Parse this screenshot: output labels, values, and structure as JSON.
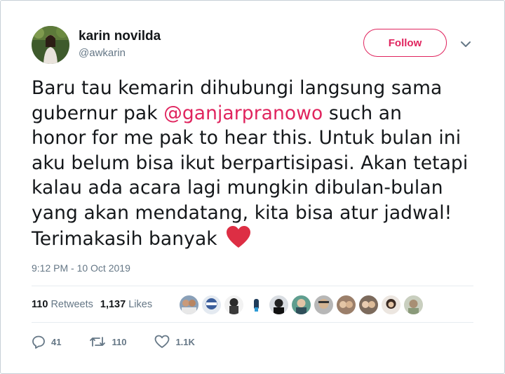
{
  "user": {
    "name": "karin novilda",
    "handle": "@awkarin"
  },
  "follow_button": {
    "label": "Follow"
  },
  "tweet": {
    "lines": [
      "Baru tau kemarin dihubungi langsung sama",
      "gubernur pak ",
      " such an",
      "honor for me pak to hear this. Untuk bulan ini",
      "aku belum bisa ikut berpartisipasi. Akan tetapi",
      "kalau ada acara lagi mungkin dibulan-bulan",
      "yang akan mendatang, kita bisa atur jadwal!",
      "Terimakasih banyak "
    ],
    "mention": "@ganjarpranowo",
    "timestamp": "9:12 PM - 10 Oct 2019"
  },
  "stats": {
    "retweets_count": "110",
    "retweets_label": "Retweets",
    "likes_count": "1,137",
    "likes_label": "Likes"
  },
  "likers": [
    {
      "icon": "liker-avatar-1"
    },
    {
      "icon": "liker-avatar-2"
    },
    {
      "icon": "liker-avatar-3"
    },
    {
      "icon": "liker-avatar-4"
    },
    {
      "icon": "liker-avatar-5"
    },
    {
      "icon": "liker-avatar-6"
    },
    {
      "icon": "liker-avatar-7"
    },
    {
      "icon": "liker-avatar-8"
    },
    {
      "icon": "liker-avatar-9"
    }
  ],
  "actions": {
    "replies": "41",
    "retweets": "110",
    "likes": "1.1K"
  },
  "colors": {
    "accent": "#e0245e",
    "muted": "#657786",
    "text": "#14171a",
    "divider": "#e6ecf0"
  }
}
